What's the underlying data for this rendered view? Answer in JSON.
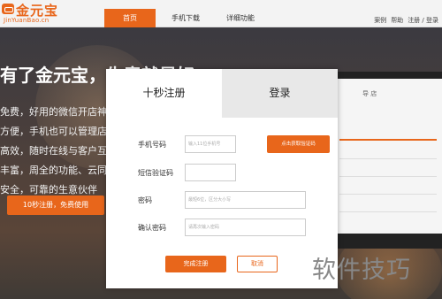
{
  "logo": {
    "text": "金元宝",
    "sub": "JinYuanBao.cn"
  },
  "nav": {
    "home": "首页",
    "app_download": "手机下载",
    "features": "详细功能"
  },
  "toplinks": [
    "案例",
    "帮助",
    "注册 / 登录"
  ],
  "hero": {
    "title": "有了金元宝，生意就是好",
    "lines": [
      "免费，好用的微信开店神器",
      "方便，手机也可以管理店铺",
      "高效，随时在线与客户互动",
      "丰富，周全的功能、云同步",
      "安全，可靠的生意伙伴"
    ],
    "cta": "10秒注册，免费使用"
  },
  "laptop": {
    "title": "导 店"
  },
  "modal": {
    "tab_register": "十秒注册",
    "tab_login": "登录",
    "phone_label": "手机号码",
    "phone_placeholder": "输入11位手机号",
    "get_code": "点击获取验证码",
    "sms_label": "短信验证码",
    "password_label": "密码",
    "password_placeholder": "最短6位，区分大小写",
    "confirm_label": "确认密码",
    "confirm_placeholder": "请再次输入密码",
    "submit": "完成注册",
    "cancel": "取消"
  },
  "watermark": "软件技巧",
  "colors": {
    "accent": "#e8661b",
    "tab_inactive": "#e8e8e8"
  }
}
